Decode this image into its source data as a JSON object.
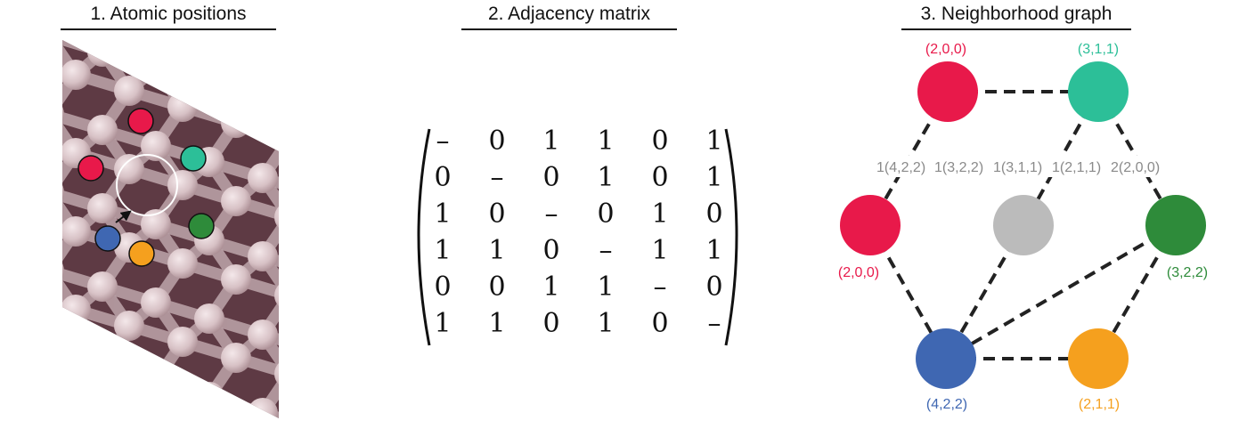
{
  "titles": {
    "panel1": "1. Atomic positions",
    "panel2": "2. Adjacency matrix",
    "panel3": "3. Neighborhood graph"
  },
  "colors": {
    "red": "#e8194a",
    "teal": "#2cbf98",
    "green": "#2e8b3a",
    "blue": "#3f67b2",
    "orange": "#f5a01e",
    "gray": "#bbbbbb",
    "surface": "#5e3a44",
    "atom": "#dcc8cc"
  },
  "matrix": [
    [
      "–",
      "0",
      "1",
      "1",
      "0",
      "1"
    ],
    [
      "0",
      "–",
      "0",
      "1",
      "0",
      "1"
    ],
    [
      "1",
      "0",
      "–",
      "0",
      "1",
      "0"
    ],
    [
      "1",
      "1",
      "0",
      "–",
      "1",
      "1"
    ],
    [
      "0",
      "0",
      "1",
      "1",
      "–",
      "0"
    ],
    [
      "1",
      "1",
      "0",
      "1",
      "0",
      "–"
    ]
  ],
  "graph": {
    "nodes": [
      {
        "id": "top-left",
        "label": "(2,0,0)",
        "color": "red"
      },
      {
        "id": "top-right",
        "label": "(3,1,1)",
        "color": "teal"
      },
      {
        "id": "mid-left",
        "label": "(2,0,0)",
        "color": "red"
      },
      {
        "id": "center",
        "label": "",
        "color": "gray"
      },
      {
        "id": "mid-right",
        "label": "(3,2,2)",
        "color": "green"
      },
      {
        "id": "bottom-left",
        "label": "(4,2,2)",
        "color": "blue"
      },
      {
        "id": "bottom-right",
        "label": "(2,1,1)",
        "color": "orange"
      }
    ],
    "edge_labels": [
      "1(4,2,2)",
      "1(3,2,2)",
      "1(3,1,1)",
      "1(2,1,1)",
      "2(2,0,0)"
    ]
  }
}
